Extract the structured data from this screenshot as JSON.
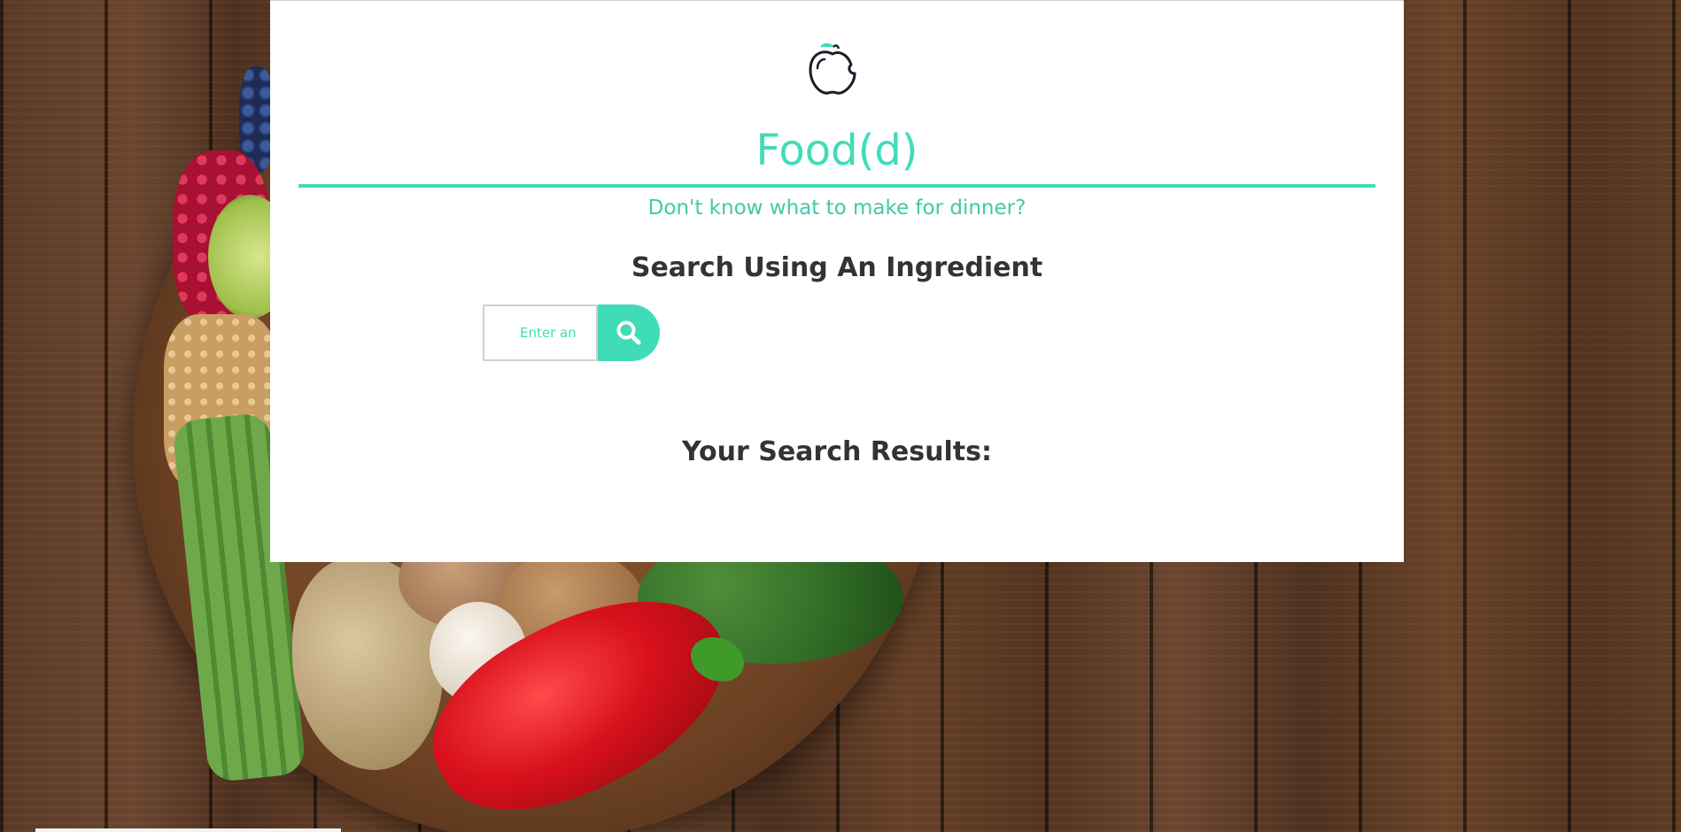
{
  "app": {
    "title": "Food(d)",
    "tagline": "Don't know what to make for dinner?"
  },
  "search": {
    "heading": "Search Using An Ingredient",
    "placeholder": "Enter an ingredient",
    "button_icon": "search-icon"
  },
  "results": {
    "heading": "Your Search Results:"
  },
  "icons": {
    "logo": "apple-icon"
  },
  "colors": {
    "accent": "#40dcb8",
    "heading_text": "#333333",
    "card_background": "#ffffff"
  }
}
